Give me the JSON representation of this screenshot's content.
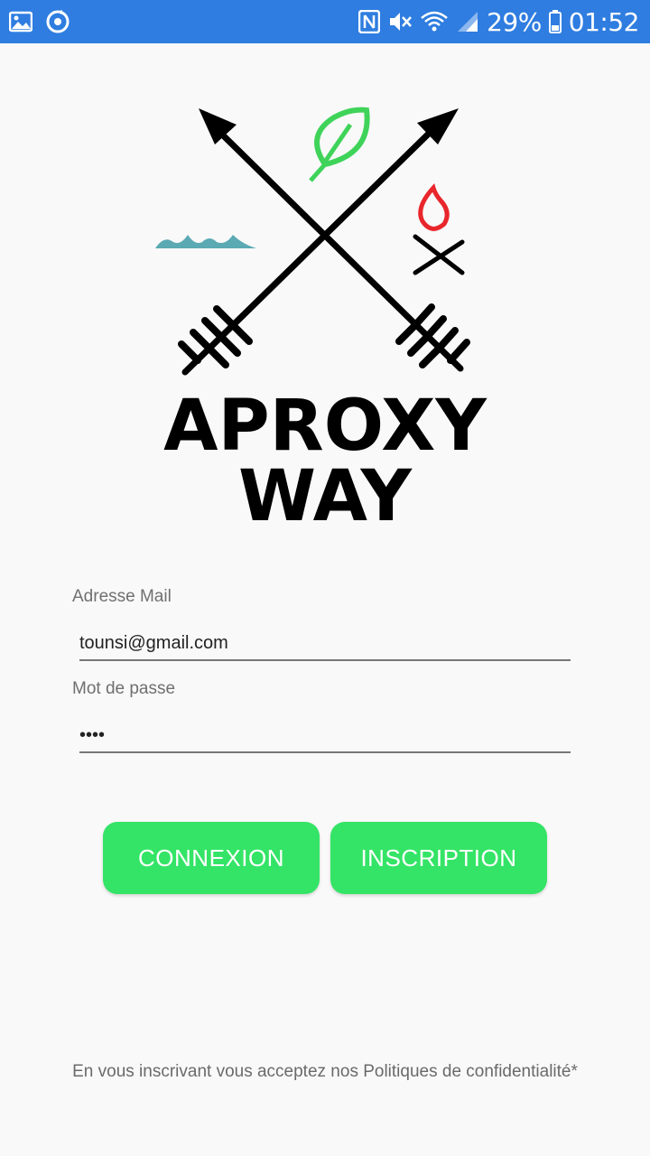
{
  "status_bar": {
    "battery": "29%",
    "time": "01:52",
    "icons": [
      "image-icon",
      "sync-icon",
      "nfc-icon",
      "vibrate-icon",
      "wifi-icon",
      "signal-icon",
      "battery-icon"
    ]
  },
  "logo": {
    "line1": "APROXY",
    "line2": "WAY"
  },
  "form": {
    "email_label": "Adresse Mail",
    "email_value": "tounsi@gmail.com",
    "password_label": "Mot de passe",
    "password_value": "••••"
  },
  "buttons": {
    "connexion": "CONNEXION",
    "inscription": "INSCRIPTION"
  },
  "footer": {
    "text": "En vous inscrivant vous acceptez nos Politiques de confidentialité*"
  },
  "colors": {
    "status_bar": "#2f7de0",
    "button": "#34e466",
    "leaf": "#3fd35a",
    "water": "#5aa9b3",
    "flame": "#e8262b"
  }
}
